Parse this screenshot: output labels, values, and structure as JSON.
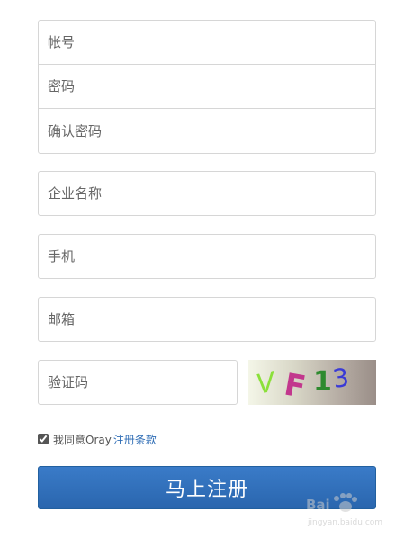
{
  "account_group": {
    "username_placeholder": "帐号",
    "password_placeholder": "密码",
    "confirm_password_placeholder": "确认密码"
  },
  "company_placeholder": "企业名称",
  "phone_placeholder": "手机",
  "email_placeholder": "邮箱",
  "captcha": {
    "placeholder": "验证码",
    "image_text": [
      "V",
      "F",
      "1",
      "3"
    ],
    "char_colors": [
      "#8be03a",
      "#c2378d",
      "#2e8a2e",
      "#3a3ad6"
    ]
  },
  "agreement": {
    "checked": true,
    "text": "我同意Oray",
    "link_text": "注册条款"
  },
  "submit_label": "马上注册",
  "watermark": {
    "main": "Bai",
    "sub": "jingyan.baidu.com"
  },
  "colors": {
    "primary": "#2f6db5",
    "border": "#d6d6d6"
  }
}
